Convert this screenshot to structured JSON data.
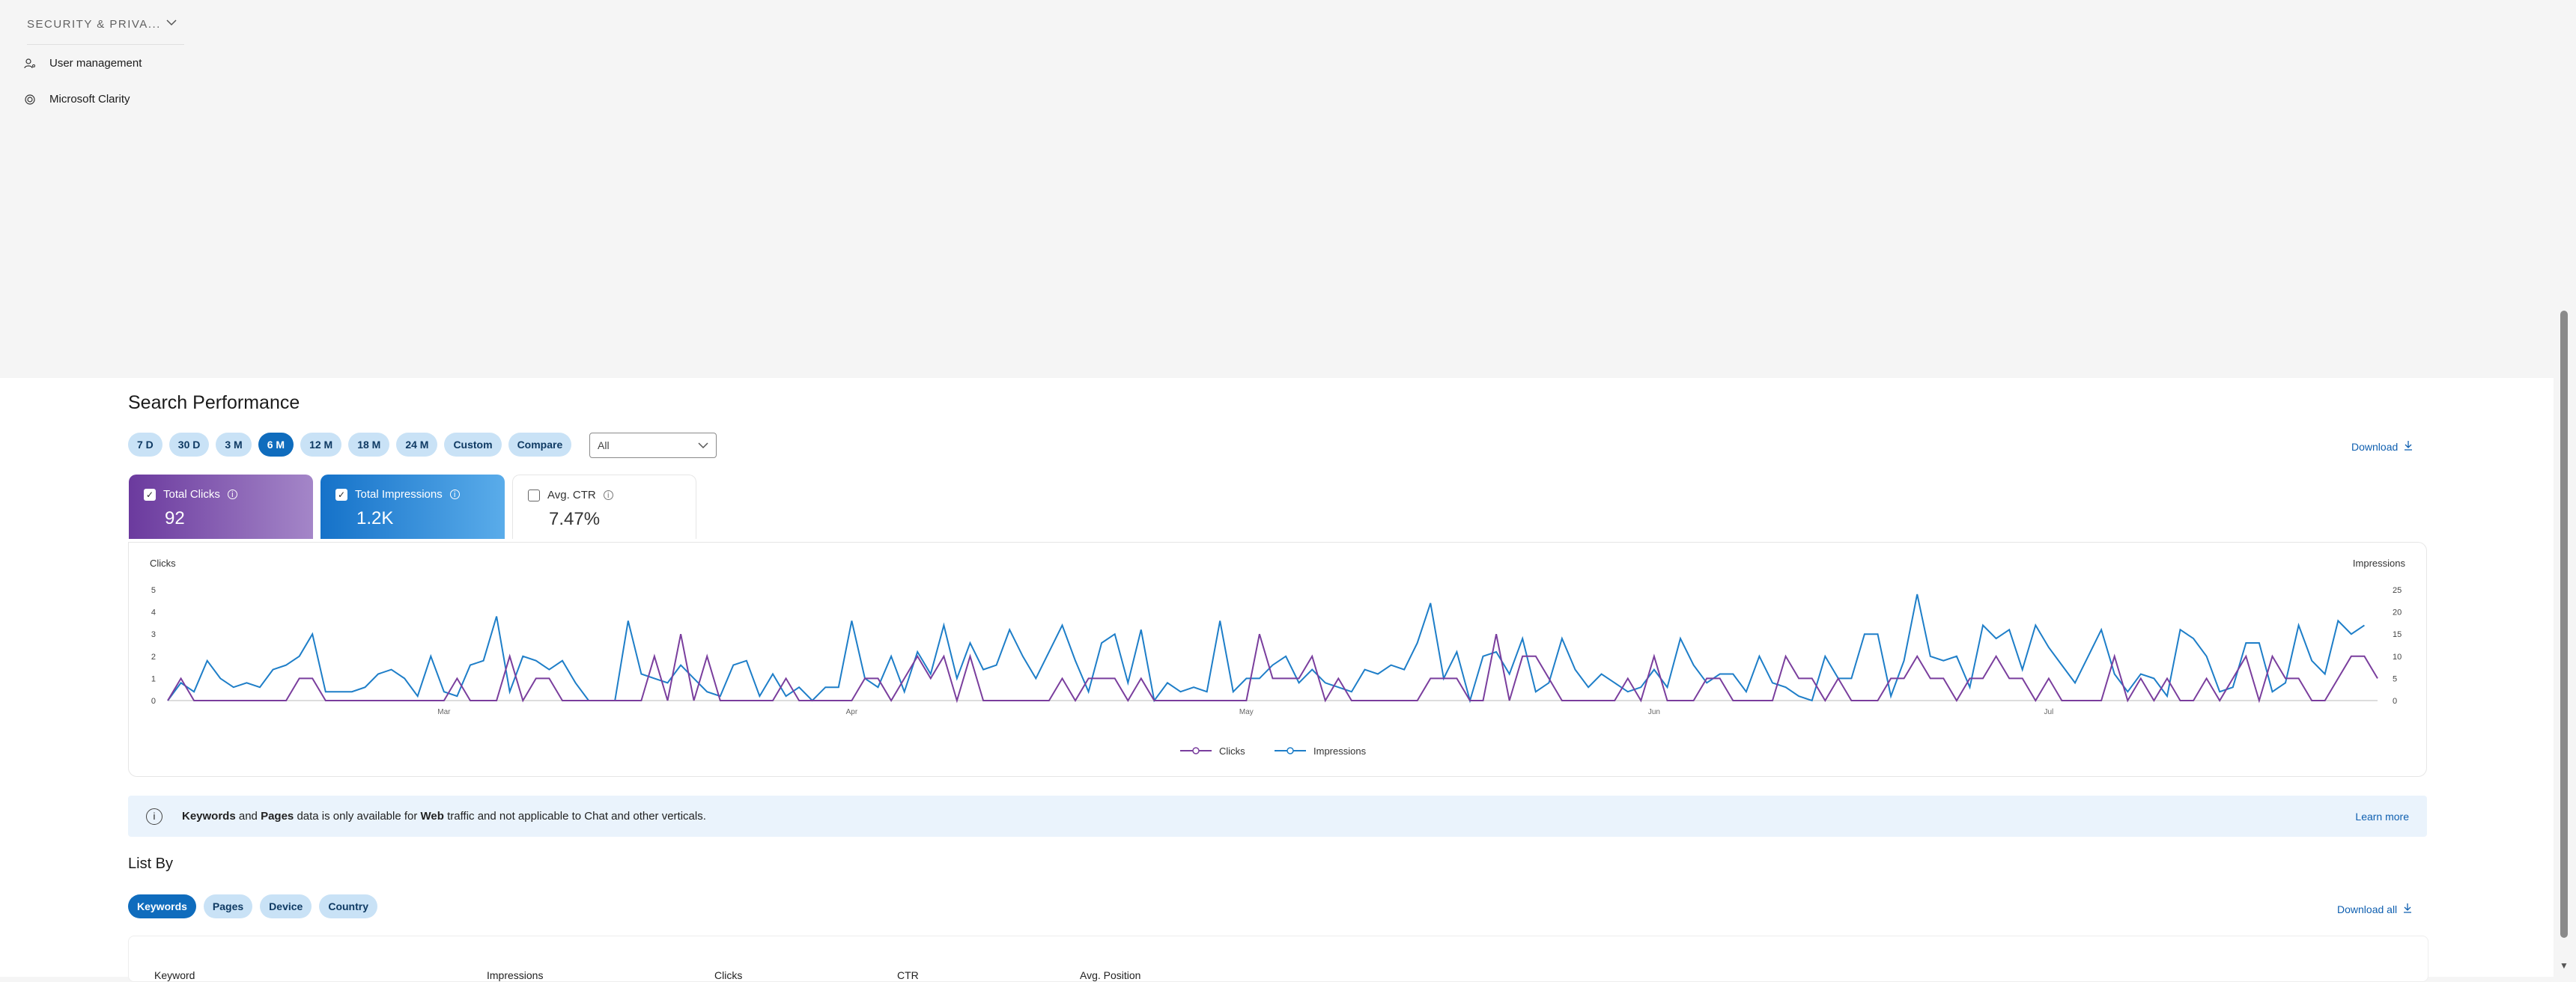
{
  "sidebar": {
    "section_title": "SECURITY & PRIVA...",
    "items": [
      {
        "label": "User management",
        "icon": "person-key-icon"
      },
      {
        "label": "Microsoft Clarity",
        "icon": "clarity-icon"
      }
    ]
  },
  "main": {
    "title": "Search Performance",
    "time_ranges": [
      {
        "label": "7 D",
        "active": false
      },
      {
        "label": "30 D",
        "active": false
      },
      {
        "label": "3 M",
        "active": false
      },
      {
        "label": "6 M",
        "active": true
      },
      {
        "label": "12 M",
        "active": false
      },
      {
        "label": "18 M",
        "active": false
      },
      {
        "label": "24 M",
        "active": false
      },
      {
        "label": "Custom",
        "active": false
      },
      {
        "label": "Compare",
        "active": false
      }
    ],
    "filter_value": "All",
    "download_label": "Download",
    "metrics": {
      "clicks": {
        "label": "Total Clicks",
        "value": "92",
        "checked": true
      },
      "impressions": {
        "label": "Total Impressions",
        "value": "1.2K",
        "checked": true
      },
      "ctr": {
        "label": "Avg. CTR",
        "value": "7.47%",
        "checked": false
      }
    },
    "banner": {
      "b1": "Keywords",
      "t1": " and ",
      "b2": "Pages",
      "t2": " data is only available for ",
      "b3": "Web",
      "t3": " traffic and not applicable to Chat and other verticals.",
      "learn_more": "Learn more"
    },
    "list_by_title": "List By",
    "list_tabs": [
      {
        "label": "Keywords",
        "active": true
      },
      {
        "label": "Pages",
        "active": false
      },
      {
        "label": "Device",
        "active": false
      },
      {
        "label": "Country",
        "active": false
      }
    ],
    "download_all_label": "Download all",
    "table_headers": [
      "Keyword",
      "Impressions",
      "Clicks",
      "CTR",
      "Avg. Position"
    ]
  },
  "chart_data": {
    "type": "line",
    "left_axis_label": "Clicks",
    "right_axis_label": "Impressions",
    "ylim_left": [
      0,
      5
    ],
    "ylim_right": [
      0,
      25
    ],
    "left_ticks": [
      "0",
      "1",
      "2",
      "3",
      "4",
      "5"
    ],
    "right_ticks": [
      "0",
      "5",
      "10",
      "15",
      "20",
      "25"
    ],
    "x_tick_labels": [
      {
        "label": "Mar",
        "index": 21
      },
      {
        "label": "Apr",
        "index": 52
      },
      {
        "label": "May",
        "index": 82
      },
      {
        "label": "Jun",
        "index": 113
      },
      {
        "label": "Jul",
        "index": 143
      }
    ],
    "colors": {
      "clicks": "#7a3e9d",
      "impressions": "#1e7ec8"
    },
    "series": [
      {
        "name": "Clicks",
        "axis": "left",
        "values": [
          0,
          1,
          0,
          0,
          0,
          0,
          0,
          0,
          0,
          0,
          1,
          1,
          0,
          0,
          0,
          0,
          0,
          0,
          0,
          0,
          0,
          0,
          1,
          0,
          0,
          0,
          2,
          0,
          1,
          1,
          0,
          0,
          0,
          0,
          0,
          0,
          0,
          2,
          0,
          3,
          0,
          2,
          0,
          0,
          0,
          0,
          0,
          1,
          0,
          0,
          0,
          0,
          0,
          1,
          1,
          0,
          1,
          2,
          1,
          2,
          0,
          2,
          0,
          0,
          0,
          0,
          0,
          0,
          1,
          0,
          1,
          1,
          1,
          0,
          1,
          0,
          0,
          0,
          0,
          0,
          0,
          0,
          0,
          3,
          1,
          1,
          1,
          2,
          0,
          1,
          0,
          0,
          0,
          0,
          0,
          0,
          1,
          1,
          1,
          0,
          0,
          3,
          0,
          2,
          2,
          1,
          0,
          0,
          0,
          0,
          0,
          1,
          0,
          2,
          0,
          0,
          0,
          1,
          1,
          0,
          0,
          0,
          0,
          2,
          1,
          1,
          0,
          1,
          0,
          0,
          0,
          1,
          1,
          2,
          1,
          1,
          0,
          1,
          1,
          2,
          1,
          1,
          0,
          1,
          0,
          0,
          0,
          0,
          2,
          0,
          1,
          0,
          1,
          0,
          0,
          1,
          0,
          1,
          2,
          0,
          2,
          1,
          1,
          0,
          0,
          1,
          2,
          2,
          1
        ]
      },
      {
        "name": "Impressions",
        "axis": "right",
        "values": [
          0,
          4,
          2,
          9,
          5,
          3,
          4,
          3,
          7,
          8,
          10,
          15,
          2,
          2,
          2,
          3,
          6,
          7,
          5,
          1,
          10,
          2,
          1,
          8,
          9,
          19,
          2,
          10,
          9,
          7,
          9,
          4,
          0,
          0,
          0,
          18,
          6,
          5,
          4,
          8,
          5,
          2,
          1,
          8,
          9,
          1,
          6,
          1,
          3,
          0,
          3,
          3,
          18,
          5,
          3,
          10,
          2,
          11,
          6,
          17,
          5,
          13,
          7,
          8,
          16,
          10,
          5,
          11,
          17,
          9,
          2,
          13,
          15,
          4,
          16,
          0,
          4,
          2,
          3,
          2,
          18,
          2,
          5,
          5,
          8,
          10,
          4,
          7,
          4,
          3,
          2,
          7,
          6,
          8,
          7,
          13,
          22,
          5,
          11,
          0,
          10,
          11,
          6,
          14,
          2,
          4,
          14,
          7,
          3,
          6,
          4,
          2,
          3,
          7,
          3,
          14,
          8,
          4,
          6,
          6,
          2,
          10,
          4,
          3,
          1,
          0,
          10,
          5,
          5,
          15,
          15,
          1,
          9,
          24,
          10,
          9,
          10,
          3,
          17,
          14,
          16,
          7,
          17,
          12,
          8,
          4,
          10,
          16,
          6,
          2,
          6,
          5,
          1,
          16,
          14,
          10,
          2,
          3,
          13,
          13,
          2,
          4,
          17,
          9,
          6,
          18,
          15,
          17
        ]
      }
    ]
  }
}
